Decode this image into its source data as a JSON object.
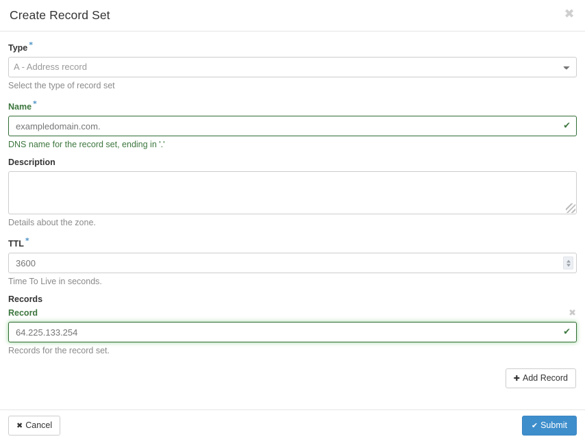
{
  "header": {
    "title": "Create Record Set",
    "close_icon": "close-icon",
    "close_glyph": "✖"
  },
  "form": {
    "type": {
      "label": "Type",
      "required_marker": "*",
      "selected_option": "A - Address record",
      "options": [
        "A - Address record"
      ],
      "help": "Select the type of record set"
    },
    "name": {
      "label": "Name",
      "required_marker": "*",
      "value": "exampledomain.com.",
      "placeholder": "exampledomain.com.",
      "help": "DNS name for the record set, ending in '.'",
      "state": "valid",
      "valid_glyph": "✔"
    },
    "description": {
      "label": "Description",
      "value": "",
      "placeholder": "",
      "help": "Details about the zone."
    },
    "ttl": {
      "label": "TTL",
      "required_marker": "*",
      "value": "3600",
      "placeholder": "3600",
      "help": "Time To Live in seconds."
    },
    "records": {
      "group_label": "Records",
      "item_label": "Record",
      "remove_glyph": "✖",
      "value": "64.225.133.254",
      "placeholder": "64.225.133.254",
      "help": "Records for the record set.",
      "state": "valid",
      "valid_glyph": "✔",
      "add_button": {
        "glyph": "✚",
        "label": "Add Record"
      }
    }
  },
  "footer": {
    "cancel": {
      "glyph": "✖",
      "label": "Cancel"
    },
    "submit": {
      "glyph": "✔",
      "label": "Submit"
    }
  },
  "colors": {
    "primary": "#3e8ecc",
    "valid_green": "#3c763d",
    "border_green": "#2e6b33",
    "required_star": "#4a90c4",
    "muted_text": "#8a8a8a"
  }
}
